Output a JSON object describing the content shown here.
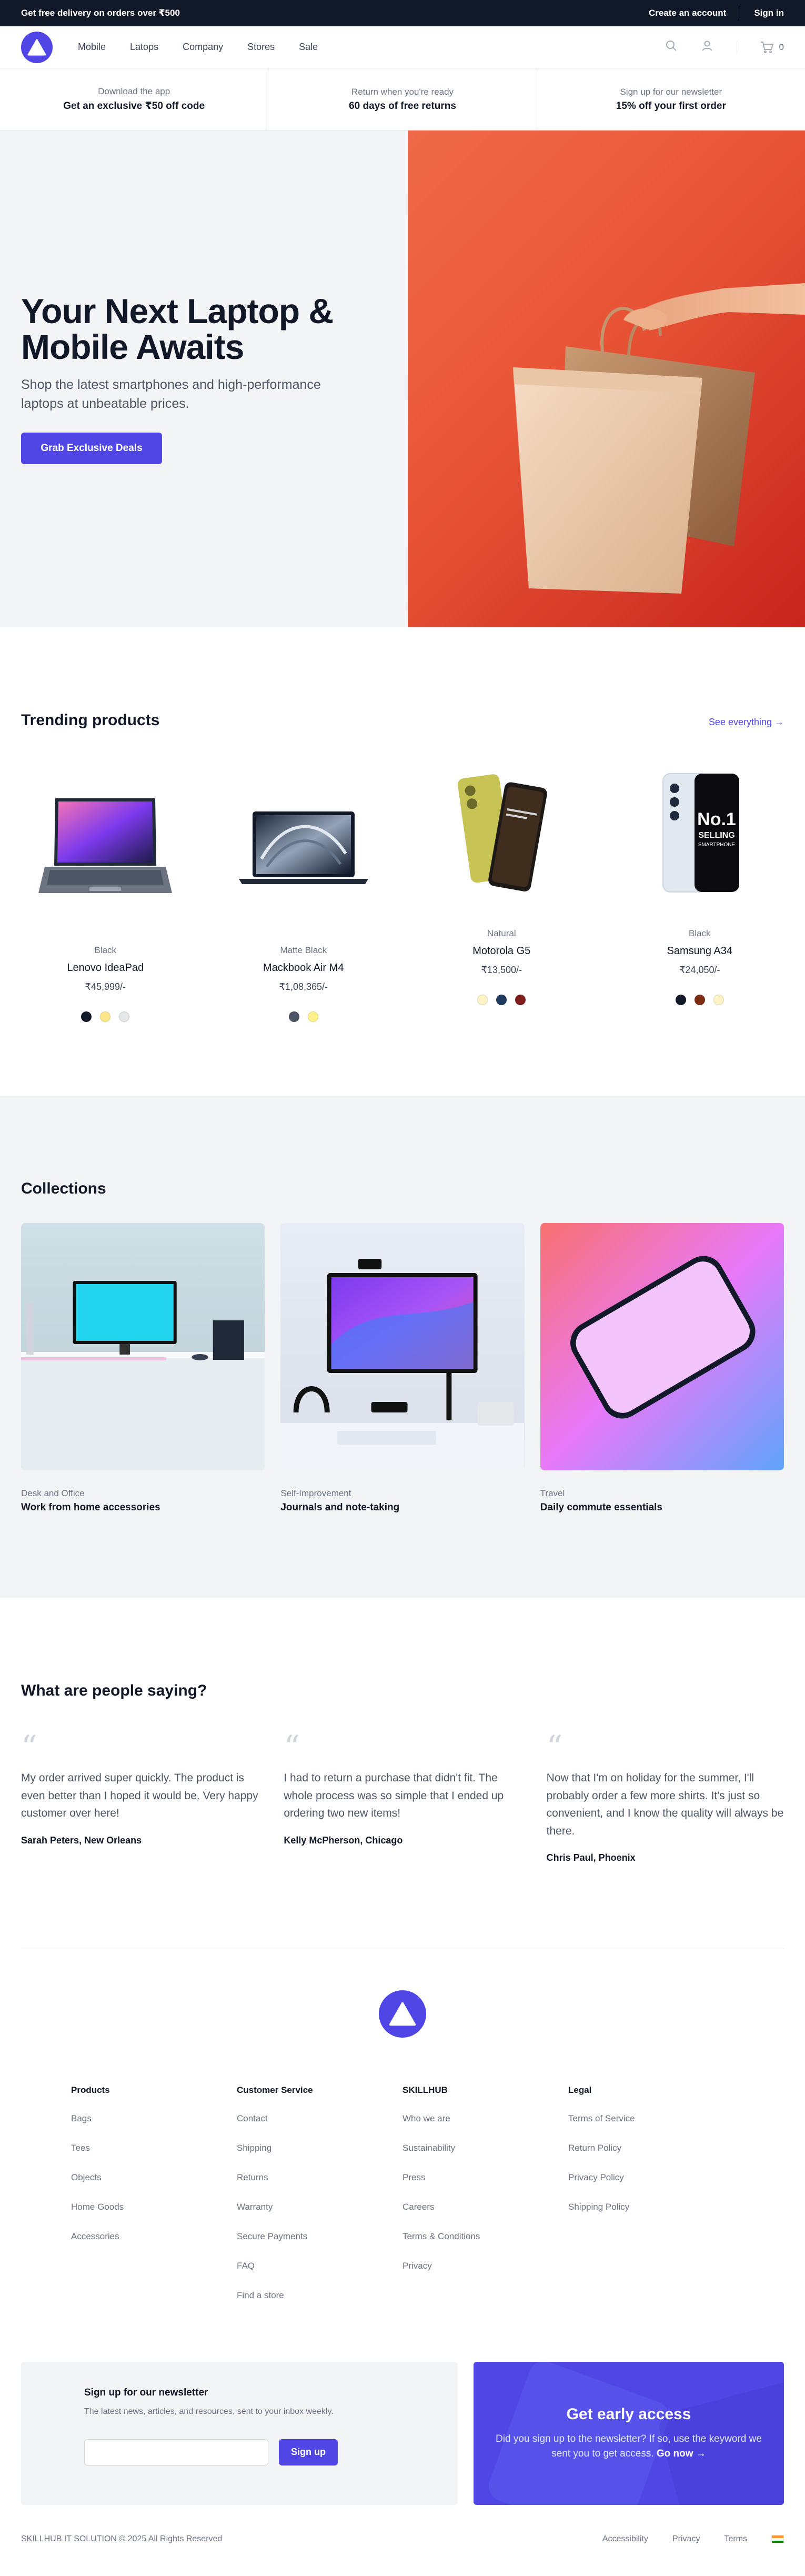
{
  "topbar": {
    "promo": "Get free delivery on orders over ₹500",
    "create_account": "Create an account",
    "sign_in": "Sign in"
  },
  "nav": {
    "links": [
      "Mobile",
      "Latops",
      "Company",
      "Stores",
      "Sale"
    ],
    "cart_count": "0"
  },
  "perks": [
    {
      "small": "Download the app",
      "big": "Get an exclusive ₹50 off code"
    },
    {
      "small": "Return when you're ready",
      "big": "60 days of free returns"
    },
    {
      "small": "Sign up for our newsletter",
      "big": "15% off your first order"
    }
  ],
  "hero": {
    "title": "Your Next Laptop & Mobile Awaits",
    "subtitle": "Shop the latest smartphones and high-performance laptops at unbeatable prices.",
    "cta": "Grab Exclusive Deals"
  },
  "trending": {
    "title": "Trending products",
    "see_all": "See everything →",
    "products": [
      {
        "color": "Black",
        "name": "Lenovo IdeaPad",
        "price": "₹45,999/-",
        "swatches": [
          "#111827",
          "#fde68a",
          "#e5e7eb"
        ]
      },
      {
        "color": "Matte Black",
        "name": "Mackbook Air M4",
        "price": "₹1,08,365/-",
        "swatches": [
          "#4b5563",
          "#fef08a"
        ]
      },
      {
        "color": "Natural",
        "name": "Motorola G5",
        "price": "₹13,500/-",
        "swatches": [
          "#fef3c7",
          "#1e3a5f",
          "#7f1d1d"
        ]
      },
      {
        "color": "Black",
        "name": "Samsung A34",
        "price": "₹24,050/-",
        "swatches": [
          "#111827",
          "#7c2d12",
          "#fef3c7"
        ]
      }
    ],
    "badge_text": {
      "no1": "No.1",
      "selling": "SELLING",
      "smartphone": "SMARTPHONE"
    }
  },
  "collections": {
    "title": "Collections",
    "items": [
      {
        "category": "Desk and Office",
        "title": "Work from home accessories"
      },
      {
        "category": "Self-Improvement",
        "title": "Journals and note-taking"
      },
      {
        "category": "Travel",
        "title": "Daily commute essentials"
      }
    ]
  },
  "testimonials": {
    "title": "What are people saying?",
    "items": [
      {
        "quote": "My order arrived super quickly. The product is even better than I hoped it would be. Very happy customer over here!",
        "author": "Sarah Peters, New Orleans"
      },
      {
        "quote": "I had to return a purchase that didn't fit. The whole process was so simple that I ended up ordering two new items!",
        "author": "Kelly McPherson, Chicago"
      },
      {
        "quote": "Now that I'm on holiday for the summer, I'll probably order a few more shirts. It's just so convenient, and I know the quality will always be there.",
        "author": "Chris Paul, Phoenix"
      }
    ]
  },
  "footer": {
    "columns": [
      {
        "heading": "Products",
        "links": [
          "Bags",
          "Tees",
          "Objects",
          "Home Goods",
          "Accessories"
        ]
      },
      {
        "heading": "Customer Service",
        "links": [
          "Contact",
          "Shipping",
          "Returns",
          "Warranty",
          "Secure Payments",
          "FAQ",
          "Find a store"
        ]
      },
      {
        "heading": "SKILLHUB",
        "links": [
          "Who we are",
          "Sustainability",
          "Press",
          "Careers",
          "Terms & Conditions",
          "Privacy"
        ]
      },
      {
        "heading": "Legal",
        "links": [
          "Terms of Service",
          "Return Policy",
          "Privacy Policy",
          "Shipping Policy"
        ]
      }
    ],
    "newsletter": {
      "title": "Sign up for our newsletter",
      "desc": "The latest news, articles, and resources, sent to your inbox weekly.",
      "input_placeholder": "",
      "button": "Sign up"
    },
    "early": {
      "title": "Get early access",
      "text": "Did you sign up to the newsletter? If so, use the keyword we sent you to get access.",
      "link": "Go now →"
    },
    "copyright": "SKILLHUB IT SOLUTION © 2025 All Rights Reserved",
    "bottom_links": [
      "Accessibility",
      "Privacy",
      "Terms"
    ]
  },
  "colors": {
    "accent": "#4f46e5",
    "dark": "#111827",
    "hero_panel": "#e85435"
  }
}
